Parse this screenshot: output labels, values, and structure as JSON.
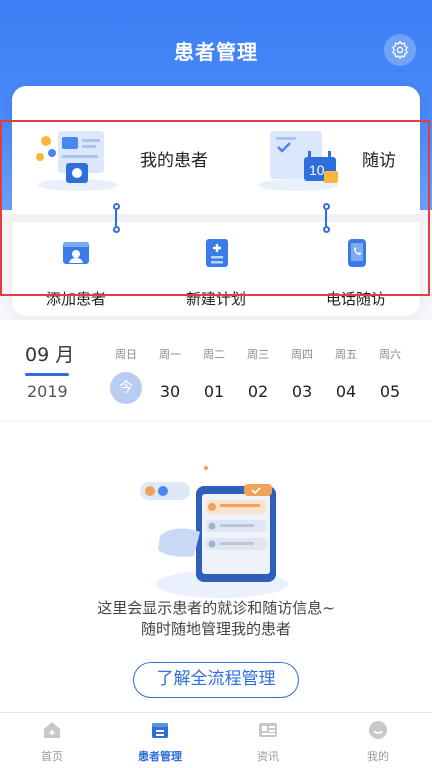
{
  "header": {
    "title": "患者管理"
  },
  "card": {
    "top_items": [
      {
        "label": "我的患者",
        "icon": "patients-illustration-icon"
      },
      {
        "label": "随访",
        "icon": "calendar-10-illustration-icon"
      }
    ],
    "bottom_items": [
      {
        "label": "添加患者",
        "icon": "add-patient-icon"
      },
      {
        "label": "新建计划",
        "icon": "new-plan-icon"
      },
      {
        "label": "电话随访",
        "icon": "phone-followup-icon"
      }
    ]
  },
  "calendar": {
    "month": "09 月",
    "year": "2019",
    "weekdays": [
      "周日",
      "周一",
      "周二",
      "周三",
      "周四",
      "周五",
      "周六"
    ],
    "today_label": "今",
    "dates": [
      "30",
      "01",
      "02",
      "03",
      "04",
      "05"
    ]
  },
  "empty_state": {
    "line1": "这里会显示患者的就诊和随访信息~",
    "line2": "随时随地管理我的患者",
    "button": "了解全流程管理"
  },
  "tabbar": {
    "tabs": [
      {
        "label": "首页",
        "icon": "home-icon"
      },
      {
        "label": "患者管理",
        "icon": "patient-management-icon"
      },
      {
        "label": "资讯",
        "icon": "news-icon"
      },
      {
        "label": "我的",
        "icon": "profile-icon"
      }
    ],
    "active_index": 1
  },
  "colors": {
    "primary": "#2f6fdc",
    "highlight": "#e43d3d"
  }
}
